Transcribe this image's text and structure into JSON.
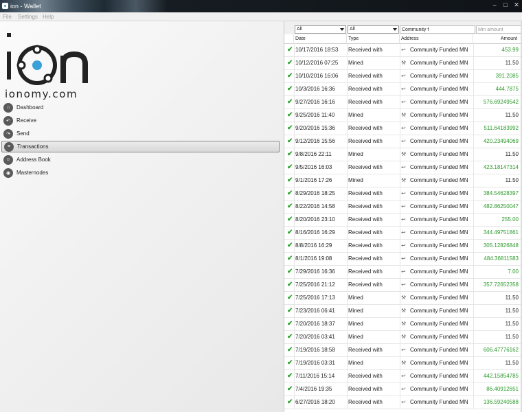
{
  "window": {
    "title": "ion - Wallet",
    "controls": [
      "–",
      "□",
      "✕"
    ]
  },
  "menu": [
    "File",
    "Settings",
    "Help"
  ],
  "logo": {
    "text": "ionomy.com"
  },
  "nav": [
    {
      "label": "Dashboard",
      "icon": "home-icon",
      "glyph": "⌂",
      "active": false
    },
    {
      "label": "Receive",
      "icon": "receive-icon",
      "glyph": "↶",
      "active": false
    },
    {
      "label": "Send",
      "icon": "send-icon",
      "glyph": "↷",
      "active": false
    },
    {
      "label": "Transactions",
      "icon": "transactions-icon",
      "glyph": "≡",
      "active": true
    },
    {
      "label": "Address Book",
      "icon": "address-book-icon",
      "glyph": "☺",
      "active": false
    },
    {
      "label": "Masternodes",
      "icon": "masternodes-icon",
      "glyph": "◉",
      "active": false
    }
  ],
  "filters": {
    "date": "All",
    "type": "All",
    "address_value": "Community f",
    "min_amount_placeholder": "Min amount"
  },
  "columns": {
    "date": "Date",
    "type": "Type",
    "address": "Address",
    "amount": "Amount"
  },
  "colors": {
    "received_amount": "#2b9a2b",
    "mined_amount": "#222222",
    "check": "#2fa52f"
  },
  "rows": [
    {
      "date": "10/17/2016 18:53",
      "type": "Received with",
      "address": "Community Funded MN",
      "amount": "453.99"
    },
    {
      "date": "10/12/2016 07:25",
      "type": "Mined",
      "address": "Community Funded MN",
      "amount": "11.50"
    },
    {
      "date": "10/10/2016 16:06",
      "type": "Received with",
      "address": "Community Funded MN",
      "amount": "391.2085"
    },
    {
      "date": "10/3/2016 16:36",
      "type": "Received with",
      "address": "Community Funded MN",
      "amount": "444.7875"
    },
    {
      "date": "9/27/2016 16:16",
      "type": "Received with",
      "address": "Community Funded MN",
      "amount": "576.69249542"
    },
    {
      "date": "9/25/2016 11:40",
      "type": "Mined",
      "address": "Community Funded MN",
      "amount": "11.50"
    },
    {
      "date": "9/20/2016 15:36",
      "type": "Received with",
      "address": "Community Funded MN",
      "amount": "511.64183992"
    },
    {
      "date": "9/12/2016 15:56",
      "type": "Received with",
      "address": "Community Funded MN",
      "amount": "420.23494069"
    },
    {
      "date": "9/8/2016 22:11",
      "type": "Mined",
      "address": "Community Funded MN",
      "amount": "11.50"
    },
    {
      "date": "9/5/2016 16:03",
      "type": "Received with",
      "address": "Community Funded MN",
      "amount": "423.18147314"
    },
    {
      "date": "9/1/2016 17:26",
      "type": "Mined",
      "address": "Community Funded MN",
      "amount": "11.50"
    },
    {
      "date": "8/29/2016 18:25",
      "type": "Received with",
      "address": "Community Funded MN",
      "amount": "384.54628397"
    },
    {
      "date": "8/22/2016 14:58",
      "type": "Received with",
      "address": "Community Funded MN",
      "amount": "482.86250047"
    },
    {
      "date": "8/20/2016 23:10",
      "type": "Received with",
      "address": "Community Funded MN",
      "amount": "255.00"
    },
    {
      "date": "8/16/2016 16:29",
      "type": "Received with",
      "address": "Community Funded MN",
      "amount": "344.49751861"
    },
    {
      "date": "8/8/2016 16:29",
      "type": "Received with",
      "address": "Community Funded MN",
      "amount": "305.12826848"
    },
    {
      "date": "8/1/2016 19:08",
      "type": "Received with",
      "address": "Community Funded MN",
      "amount": "484.36811583"
    },
    {
      "date": "7/29/2016 16:36",
      "type": "Received with",
      "address": "Community Funded MN",
      "amount": "7.00"
    },
    {
      "date": "7/25/2016 21:12",
      "type": "Received with",
      "address": "Community Funded MN",
      "amount": "357.72652358"
    },
    {
      "date": "7/25/2016 17:13",
      "type": "Mined",
      "address": "Community Funded MN",
      "amount": "11.50"
    },
    {
      "date": "7/23/2016 06:41",
      "type": "Mined",
      "address": "Community Funded MN",
      "amount": "11.50"
    },
    {
      "date": "7/20/2016 18:37",
      "type": "Mined",
      "address": "Community Funded MN",
      "amount": "11.50"
    },
    {
      "date": "7/20/2016 03:41",
      "type": "Mined",
      "address": "Community Funded MN",
      "amount": "11.50"
    },
    {
      "date": "7/19/2016 18:58",
      "type": "Received with",
      "address": "Community Funded MN",
      "amount": "606.47776162"
    },
    {
      "date": "7/19/2016 03:31",
      "type": "Mined",
      "address": "Community Funded MN",
      "amount": "11.50"
    },
    {
      "date": "7/11/2016 15:14",
      "type": "Received with",
      "address": "Community Funded MN",
      "amount": "442.15854785"
    },
    {
      "date": "7/4/2016 19:35",
      "type": "Received with",
      "address": "Community Funded MN",
      "amount": "86.40912651"
    },
    {
      "date": "6/27/2016 18:20",
      "type": "Received with",
      "address": "Community Funded MN",
      "amount": "136.59240588"
    }
  ]
}
